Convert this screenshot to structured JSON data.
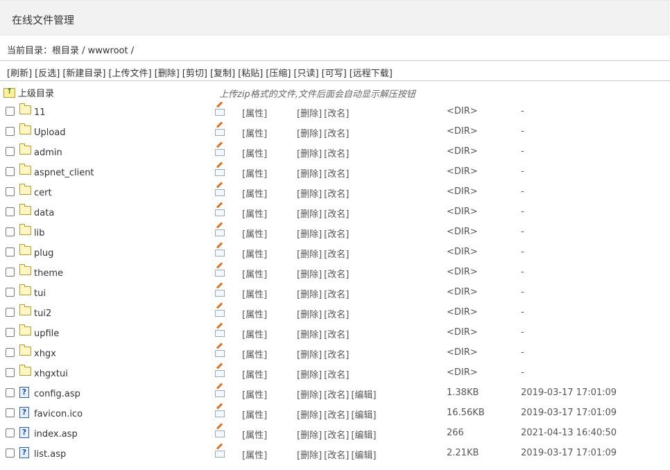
{
  "header": {
    "title": "在线文件管理"
  },
  "path": {
    "text": "当前目录：根目录 / wwwroot /"
  },
  "toolbar": [
    "[刷新]",
    "[反选]",
    "[新建目录]",
    "[上传文件]",
    "[删除]",
    "[剪切]",
    "[复制]",
    "[粘贴]",
    "[压缩]",
    "[只读]",
    "[可写]",
    "[远程下载]"
  ],
  "up": {
    "label": "上级目录",
    "hint": "上传zip格式的文件,文件后面会自动显示解压按钮"
  },
  "labels": {
    "attr": "[属性]",
    "delete": "[删除]",
    "rename": "[改名]",
    "edit": "[编辑]"
  },
  "rows": [
    {
      "name": "11",
      "type": "dir",
      "size": "<DIR>",
      "mtime": "-"
    },
    {
      "name": "Upload",
      "type": "dir",
      "size": "<DIR>",
      "mtime": "-"
    },
    {
      "name": "admin",
      "type": "dir",
      "size": "<DIR>",
      "mtime": "-"
    },
    {
      "name": "aspnet_client",
      "type": "dir",
      "size": "<DIR>",
      "mtime": "-"
    },
    {
      "name": "cert",
      "type": "dir",
      "size": "<DIR>",
      "mtime": "-"
    },
    {
      "name": "data",
      "type": "dir",
      "size": "<DIR>",
      "mtime": "-"
    },
    {
      "name": "lib",
      "type": "dir",
      "size": "<DIR>",
      "mtime": "-"
    },
    {
      "name": "plug",
      "type": "dir",
      "size": "<DIR>",
      "mtime": "-"
    },
    {
      "name": "theme",
      "type": "dir",
      "size": "<DIR>",
      "mtime": "-"
    },
    {
      "name": "tui",
      "type": "dir",
      "size": "<DIR>",
      "mtime": "-"
    },
    {
      "name": "tui2",
      "type": "dir",
      "size": "<DIR>",
      "mtime": "-"
    },
    {
      "name": "upfile",
      "type": "dir",
      "size": "<DIR>",
      "mtime": "-"
    },
    {
      "name": "xhgx",
      "type": "dir",
      "size": "<DIR>",
      "mtime": "-"
    },
    {
      "name": "xhgxtui",
      "type": "dir",
      "size": "<DIR>",
      "mtime": "-"
    },
    {
      "name": "config.asp",
      "type": "file",
      "size": "1.38KB",
      "mtime": "2019-03-17 17:01:09"
    },
    {
      "name": "favicon.ico",
      "type": "file",
      "size": "16.56KB",
      "mtime": "2019-03-17 17:01:09"
    },
    {
      "name": "index.asp",
      "type": "file",
      "size": "266",
      "mtime": "2021-04-13 16:40:50"
    },
    {
      "name": "list.asp",
      "type": "file",
      "size": "2.21KB",
      "mtime": "2019-03-17 17:01:09"
    }
  ]
}
